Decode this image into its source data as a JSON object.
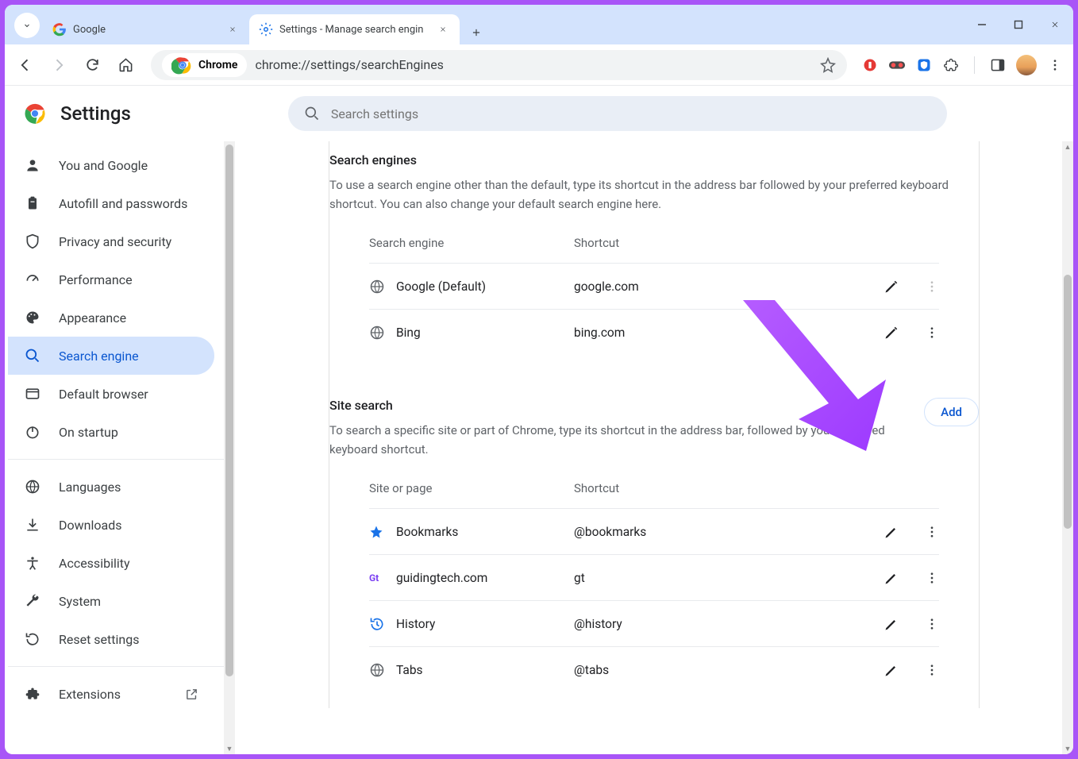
{
  "window": {
    "tabs": [
      {
        "title": "Google",
        "active": false
      },
      {
        "title": "Settings - Manage search engin",
        "active": true
      }
    ]
  },
  "toolbar": {
    "chrome_chip": "Chrome",
    "url": "chrome://settings/searchEngines"
  },
  "settings": {
    "app_title": "Settings",
    "search_placeholder": "Search settings"
  },
  "sidebar": {
    "items": [
      {
        "id": "you",
        "label": "You and Google"
      },
      {
        "id": "autofill",
        "label": "Autofill and passwords"
      },
      {
        "id": "privacy",
        "label": "Privacy and security"
      },
      {
        "id": "performance",
        "label": "Performance"
      },
      {
        "id": "appearance",
        "label": "Appearance"
      },
      {
        "id": "search",
        "label": "Search engine"
      },
      {
        "id": "default",
        "label": "Default browser"
      },
      {
        "id": "startup",
        "label": "On startup"
      }
    ],
    "items2": [
      {
        "id": "languages",
        "label": "Languages"
      },
      {
        "id": "downloads",
        "label": "Downloads"
      },
      {
        "id": "accessibility",
        "label": "Accessibility"
      },
      {
        "id": "system",
        "label": "System"
      },
      {
        "id": "reset",
        "label": "Reset settings"
      }
    ],
    "extensions_label": "Extensions"
  },
  "content": {
    "search_engines": {
      "title": "Search engines",
      "desc": "To use a search engine other than the default, type its shortcut in the address bar followed by your preferred keyboard shortcut. You can also change your default search engine here.",
      "head_engine": "Search engine",
      "head_shortcut": "Shortcut",
      "rows": [
        {
          "name": "Google (Default)",
          "shortcut": "google.com",
          "menu_dim": true
        },
        {
          "name": "Bing",
          "shortcut": "bing.com",
          "menu_dim": false
        }
      ]
    },
    "site_search": {
      "title": "Site search",
      "add_label": "Add",
      "desc": "To search a specific site or part of Chrome, type its shortcut in the address bar, followed by your preferred keyboard shortcut.",
      "head_site": "Site or page",
      "head_shortcut": "Shortcut",
      "rows": [
        {
          "icon": "star",
          "name": "Bookmarks",
          "shortcut": "@bookmarks"
        },
        {
          "icon": "gt",
          "name": "guidingtech.com",
          "shortcut": "gt"
        },
        {
          "icon": "history",
          "name": "History",
          "shortcut": "@history"
        },
        {
          "icon": "globe",
          "name": "Tabs",
          "shortcut": "@tabs"
        }
      ]
    }
  }
}
